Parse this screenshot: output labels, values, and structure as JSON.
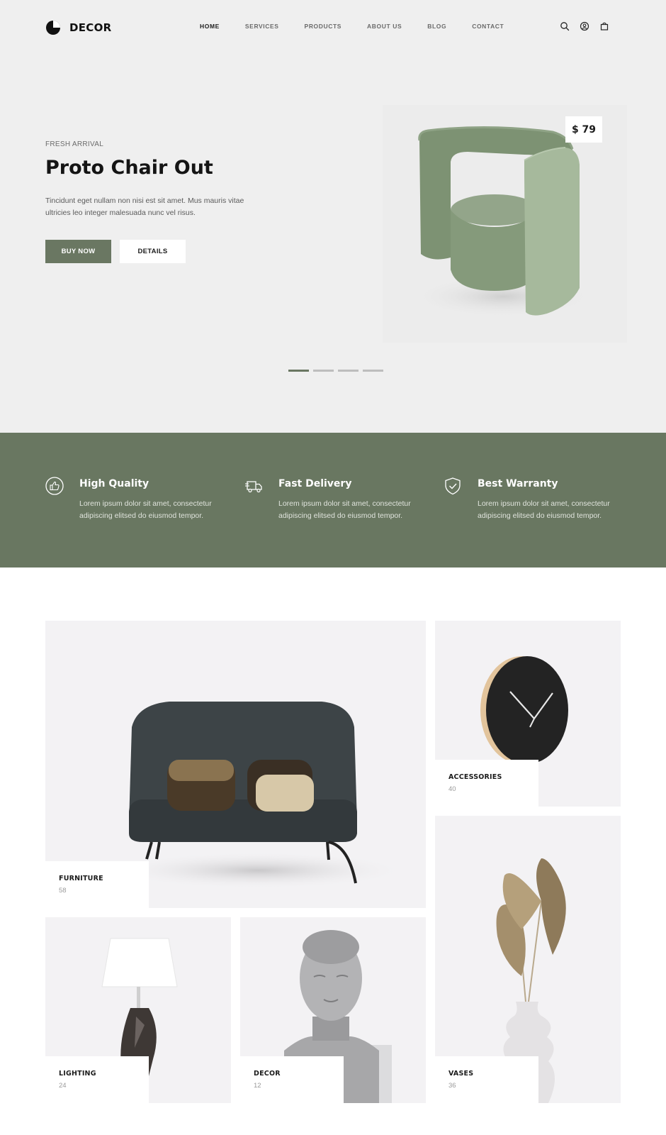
{
  "brand": {
    "name": "DECOR"
  },
  "nav": {
    "items": [
      {
        "label": "HOME",
        "active": true
      },
      {
        "label": "SERVICES",
        "active": false
      },
      {
        "label": "PRODUCTS",
        "active": false
      },
      {
        "label": "ABOUT US",
        "active": false
      },
      {
        "label": "BLOG",
        "active": false
      },
      {
        "label": "CONTACT",
        "active": false
      }
    ],
    "icons": [
      "search-icon",
      "user-icon",
      "bag-icon"
    ]
  },
  "hero": {
    "eyebrow": "FRESH ARRIVAL",
    "title": "Proto Chair Out",
    "description": "Tincidunt eget nullam non nisi est sit amet. Mus mauris vitae ultricies leo integer malesuada nunc vel risus.",
    "buy_label": "BUY NOW",
    "details_label": "DETAILS",
    "price": "$ 79",
    "slides": {
      "count": 4,
      "active": 1
    }
  },
  "features": [
    {
      "icon": "thumbs-up-icon",
      "title": "High Quality",
      "description": "Lorem ipsum dolor sit amet, consectetur adipiscing elitsed do eiusmod tempor."
    },
    {
      "icon": "delivery-truck-icon",
      "title": "Fast Delivery",
      "description": "Lorem ipsum dolor sit amet, consectetur adipiscing elitsed do eiusmod tempor."
    },
    {
      "icon": "shield-check-icon",
      "title": "Best Warranty",
      "description": "Lorem ipsum dolor sit amet, consectetur adipiscing elitsed do eiusmod tempor."
    }
  ],
  "categories": [
    {
      "name": "FURNITURE",
      "count": "58"
    },
    {
      "name": "ACCESSORIES",
      "count": "40"
    },
    {
      "name": "LIGHTING",
      "count": "24"
    },
    {
      "name": "DECOR",
      "count": "12"
    },
    {
      "name": "VASES",
      "count": "36"
    }
  ],
  "colors": {
    "accent": "#6a7762",
    "hero_bg": "#efefef",
    "card_bg": "#f3f2f4"
  }
}
